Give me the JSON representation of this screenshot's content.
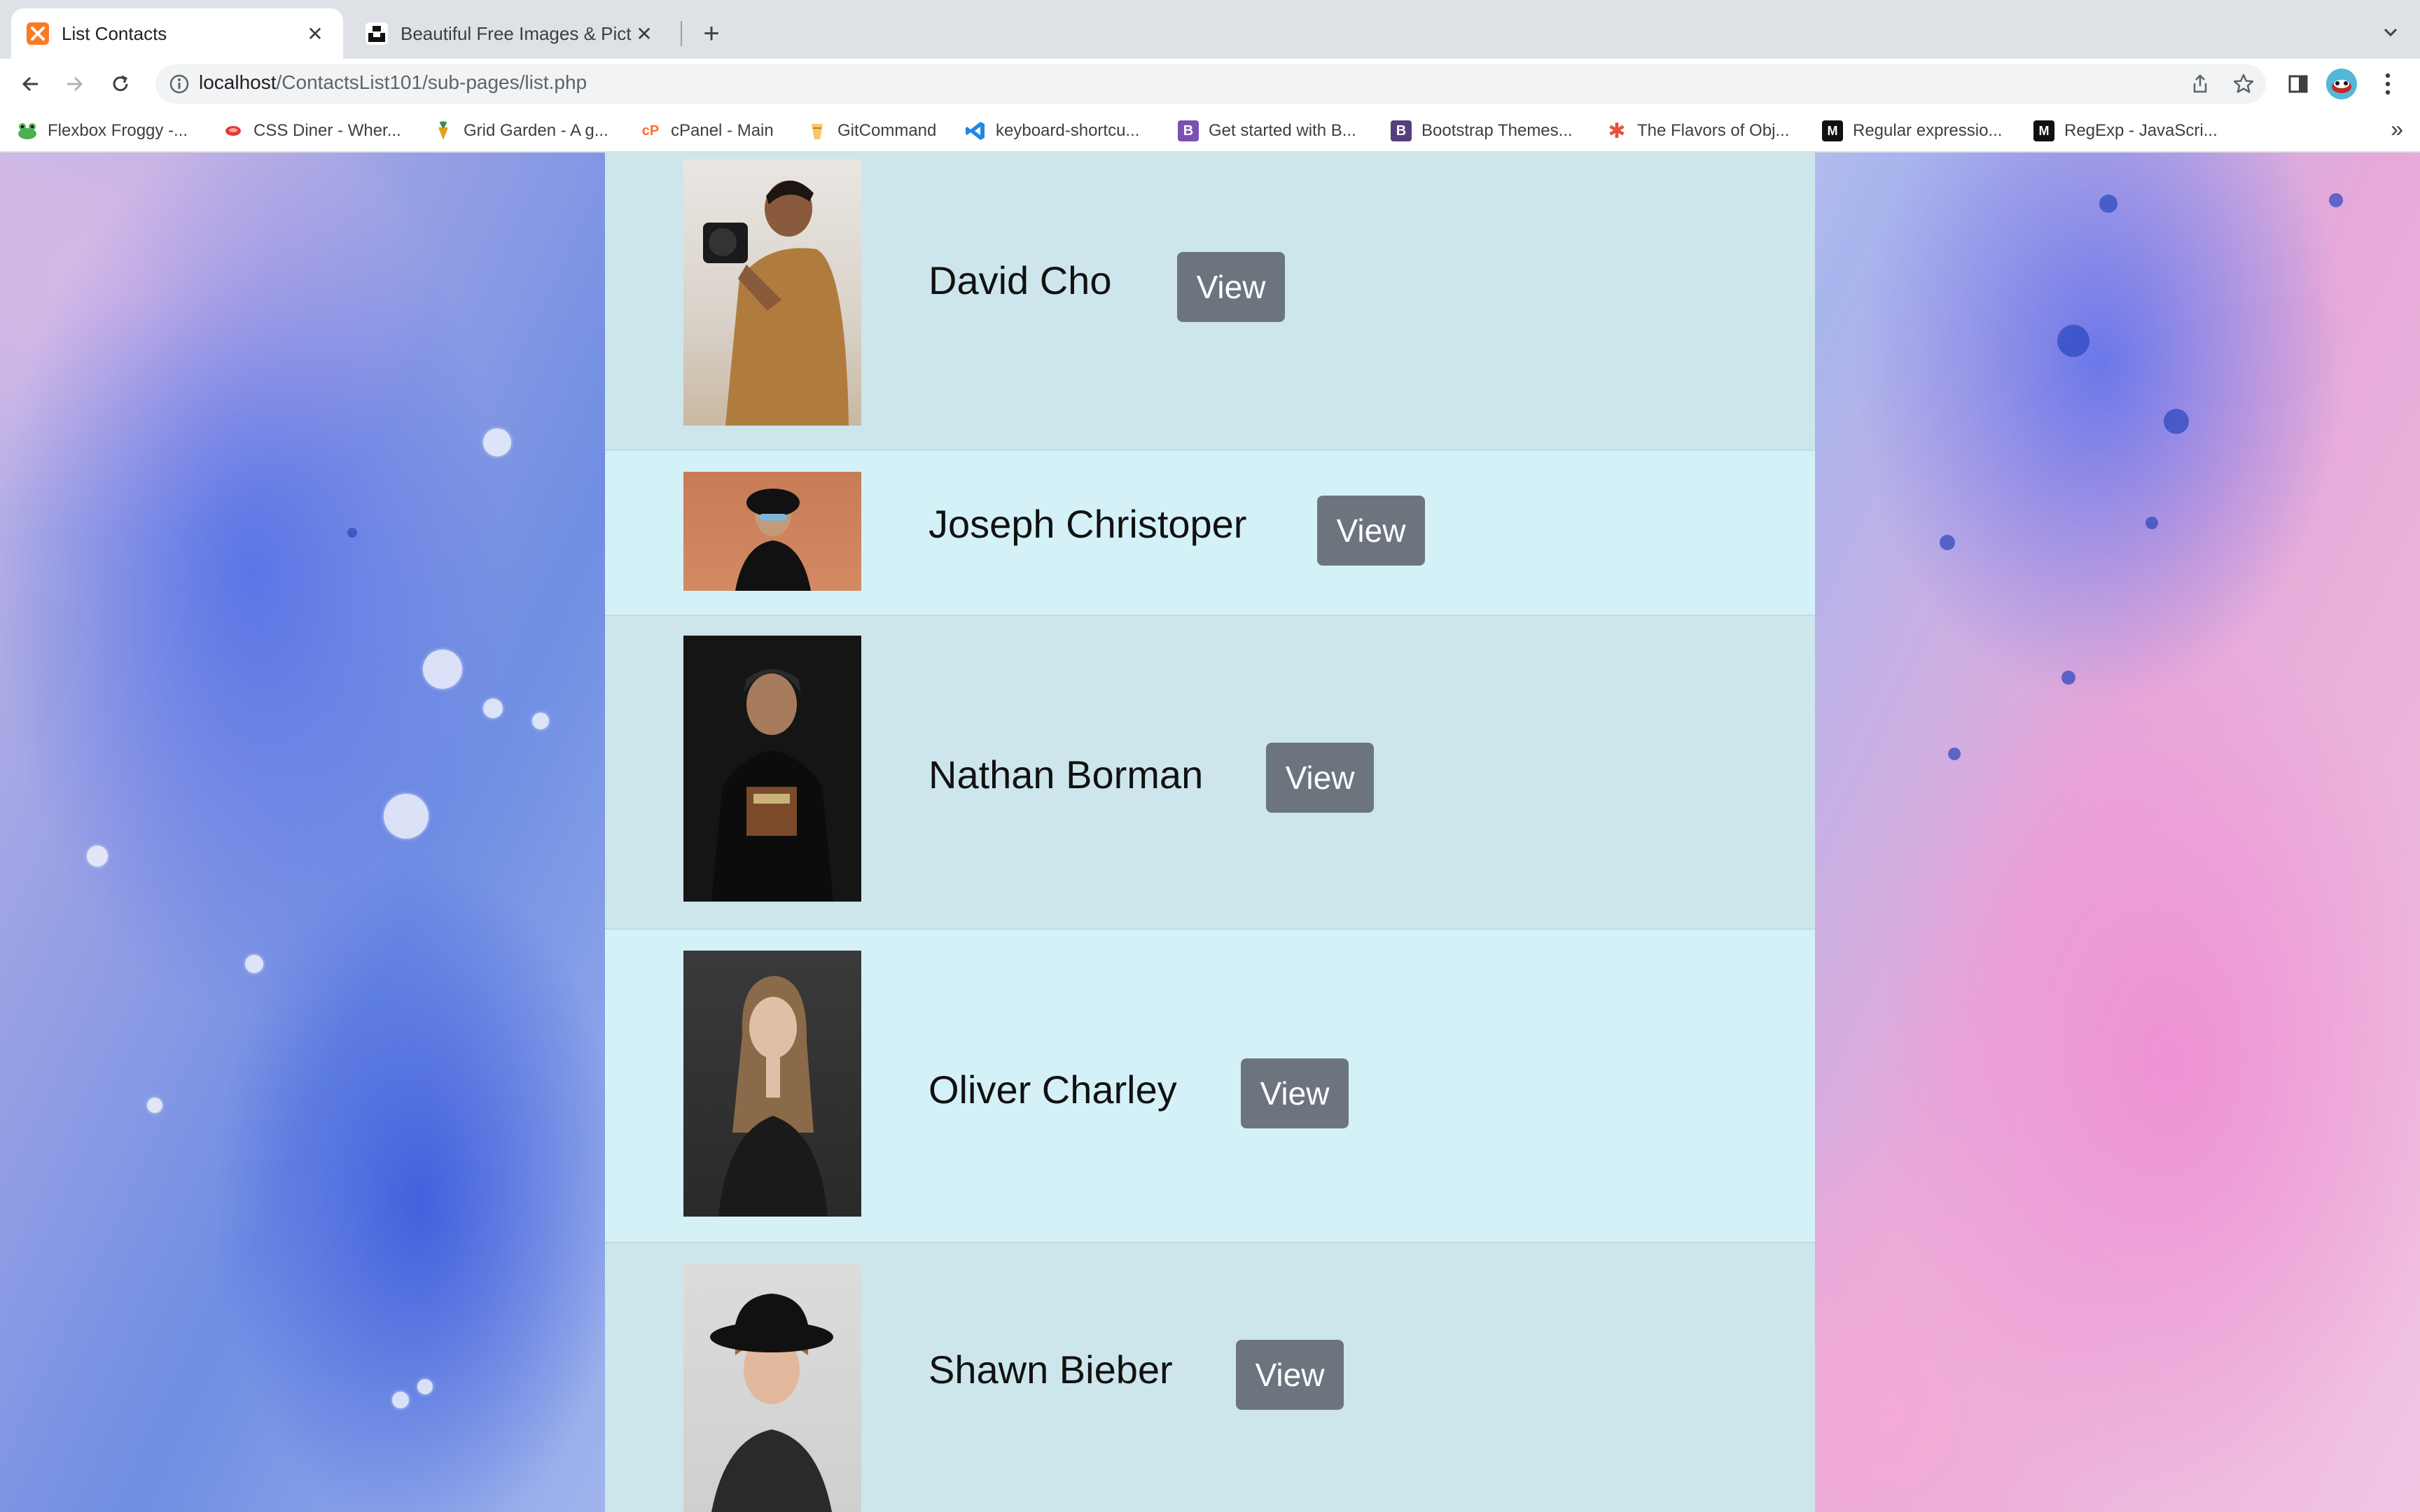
{
  "browser": {
    "tabs": [
      {
        "title": "List Contacts",
        "active": true,
        "favicon": "xampp-icon"
      },
      {
        "title": "Beautiful Free Images & Pictures",
        "active": false,
        "favicon": "unsplash-icon"
      }
    ],
    "address": {
      "host": "localhost",
      "path": "/ContactsList101/sub-pages/list.php"
    },
    "bookmarks": [
      {
        "label": "Flexbox Froggy -...",
        "icon": "frog-icon",
        "color": "#4caf50"
      },
      {
        "label": "CSS Diner - Wher...",
        "icon": "plate-icon",
        "color": "#e53935"
      },
      {
        "label": "Grid Garden - A g...",
        "icon": "carrot-icon",
        "color": "#d4a017"
      },
      {
        "label": "cPanel - Main",
        "icon": "cpanel-icon",
        "color": "#ff6c2c"
      },
      {
        "label": "GitCommand",
        "icon": "git-icon",
        "color": "#b8860b"
      },
      {
        "label": "keyboard-shortcu...",
        "icon": "vscode-icon",
        "color": "#1f88e5"
      },
      {
        "label": "Get started with B...",
        "icon": "bootstrap-icon",
        "color": "#7952b3"
      },
      {
        "label": "Bootstrap Themes...",
        "icon": "bootstrap-icon",
        "color": "#563d7c"
      },
      {
        "label": "The Flavors of Obj...",
        "icon": "asterisk-icon",
        "color": "#e5533d"
      },
      {
        "label": "Regular expressio...",
        "icon": "mdn-icon",
        "color": "#111111"
      },
      {
        "label": "RegExp - JavaScri...",
        "icon": "mdn-icon",
        "color": "#111111"
      }
    ],
    "bookmarks_more": "»"
  },
  "contacts": [
    {
      "name": "David Cho",
      "button": "View"
    },
    {
      "name": "Joseph Christoper",
      "button": "View"
    },
    {
      "name": "Nathan Borman",
      "button": "View"
    },
    {
      "name": "Oliver Charley",
      "button": "View"
    },
    {
      "name": "Shawn Bieber",
      "button": "View"
    }
  ],
  "colors": {
    "row_a": "#cde6ec",
    "row_b": "#d5f1f8",
    "button": "#6c757d"
  }
}
